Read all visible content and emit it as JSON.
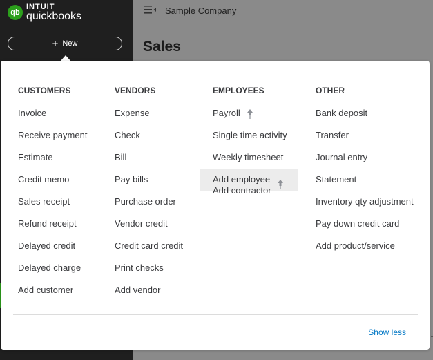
{
  "brand": {
    "logo": "qb",
    "intuit": "INTUIT",
    "name": "quickbooks"
  },
  "new_button": {
    "label": "New"
  },
  "header": {
    "company": "Sample Company"
  },
  "page": {
    "title": "Sales"
  },
  "menu": {
    "columns": [
      {
        "heading": "CUSTOMERS",
        "items": [
          "Invoice",
          "Receive payment",
          "Estimate",
          "Credit memo",
          "Sales receipt",
          "Refund receipt",
          "Delayed credit",
          "Delayed charge",
          "Add customer"
        ]
      },
      {
        "heading": "VENDORS",
        "items": [
          "Expense",
          "Check",
          "Bill",
          "Pay bills",
          "Purchase order",
          "Vendor credit",
          "Credit card credit",
          "Print checks",
          "Add vendor"
        ]
      },
      {
        "heading": "EMPLOYEES",
        "items": [
          "Payroll",
          "Single time activity",
          "Weekly timesheet",
          "Add employee",
          "Add contractor"
        ]
      },
      {
        "heading": "OTHER",
        "items": [
          "Bank deposit",
          "Transfer",
          "Journal entry",
          "Statement",
          "Inventory qty adjustment",
          "Pay down credit card",
          "Add product/service"
        ]
      }
    ],
    "show_less": "Show less"
  },
  "icons": {
    "hamburger": "menu-collapse-icon",
    "plus": "plus-icon",
    "pin": "pin-icon"
  },
  "colors": {
    "sidebar": "#1f1f1f",
    "brand_green": "#2ca01c",
    "link_blue": "#0077c5",
    "highlight": "#ececec"
  }
}
